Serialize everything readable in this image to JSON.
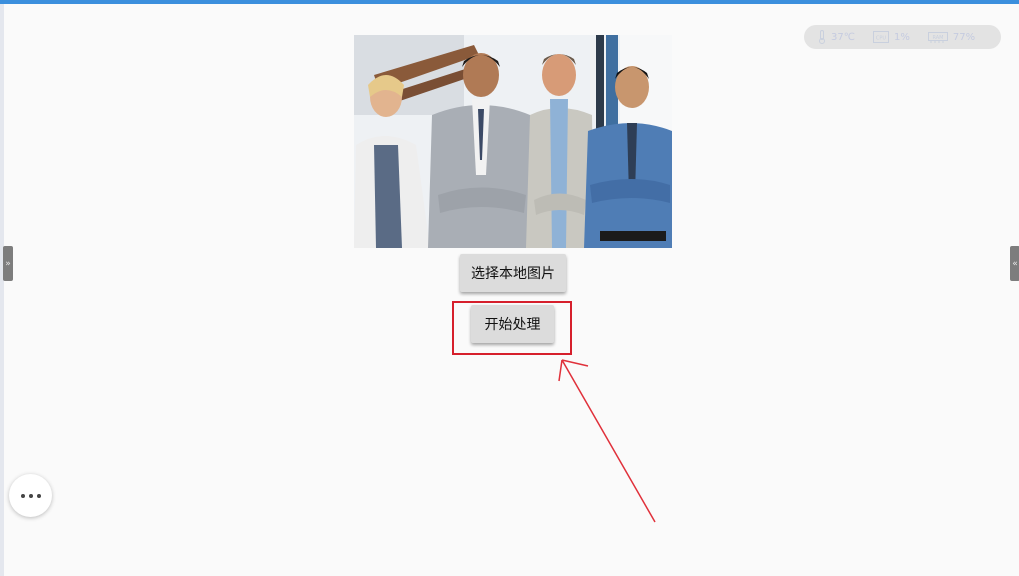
{
  "buttons": {
    "select_local_image": "选择本地图片",
    "start_processing": "开始处理"
  },
  "status": {
    "temperature": "37℃",
    "cpu_label": "CPU",
    "cpu": "1%",
    "memory_label": "RAM",
    "memory": "77%"
  },
  "side_tabs": {
    "left": "»",
    "right": "«"
  },
  "icons": [
    "thermometer-icon",
    "cpu-icon",
    "memory-icon",
    "more-dots-icon",
    "expand-left-icon",
    "expand-right-icon"
  ],
  "colors": {
    "top_bar": "#3b8fdd",
    "highlight": "#d61f2c",
    "button_bg": "#dcdcdc",
    "page_bg": "#fafafa"
  },
  "image": {
    "content": "photo-of-four-business-people"
  }
}
